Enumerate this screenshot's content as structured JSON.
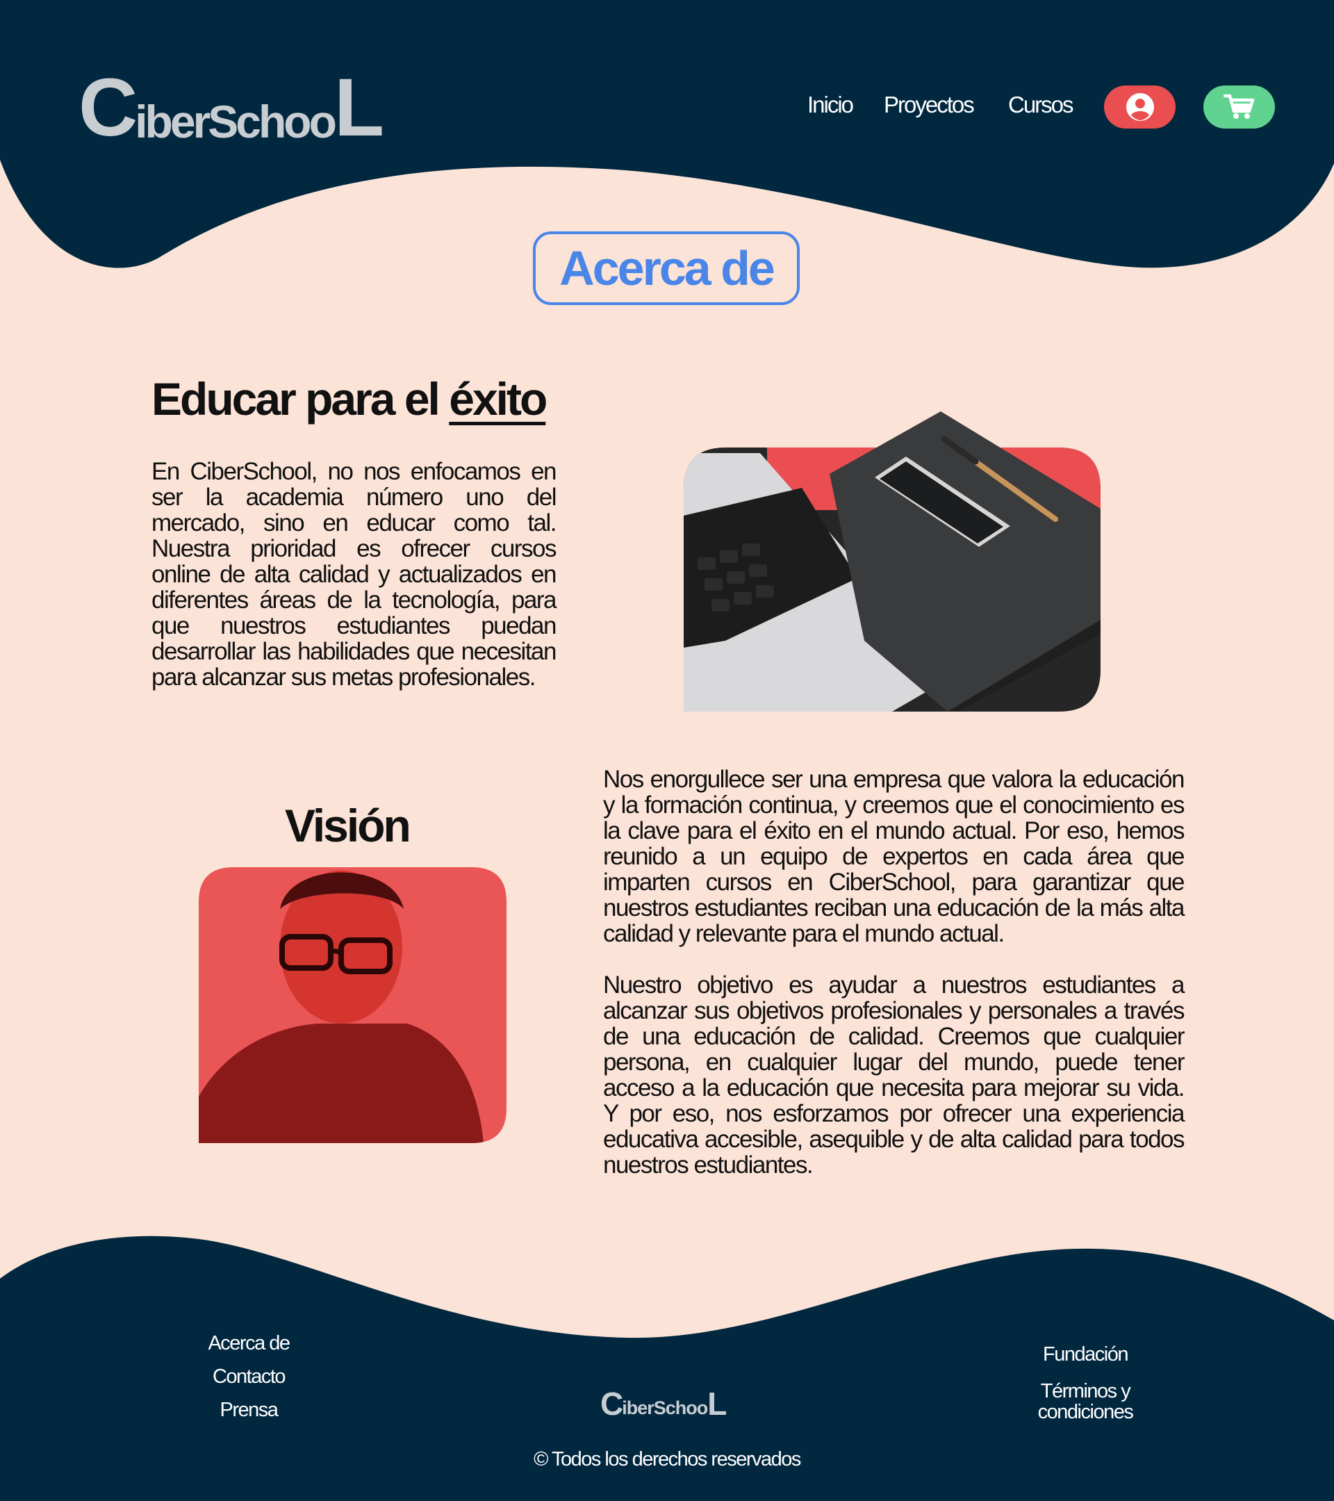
{
  "header": {
    "logo_big_c": "C",
    "logo_middle": "iberSchoo",
    "logo_big_l": "L",
    "nav": {
      "home": "Inicio",
      "projects": "Proyectos",
      "courses": "Cursos"
    }
  },
  "colors": {
    "navy": "#022840",
    "peach": "#fce3d7",
    "accent_blue": "#4a86e8",
    "user_button": "#ea4e50",
    "cart_button": "#5fd38f",
    "logo_grey": "#c8cdd2"
  },
  "icons": {
    "user": "user-circle-icon",
    "cart": "shopping-cart-icon"
  },
  "page": {
    "title": "Acerca de"
  },
  "about": {
    "heading_prefix": "Educar para el",
    "heading_underlined": "éxito",
    "body": "En CiberSchool, no nos enfocamos en ser la academia número uno del mercado, sino en educar como tal. Nuestra prioridad es ofrecer cursos online de alta calidad y actualizados en diferentes áreas de la tecnología, para que nuestros estudiantes puedan desarrollar las habilidades que necesitan para alcanzar sus metas profesionales."
  },
  "vision": {
    "heading": "Visión",
    "para1": "Nos enorgullece ser una empresa que valora la educación y la formación continua, y creemos que el conocimiento es la clave para el éxito en el mundo actual. Por eso, hemos reunido a un equipo de expertos en cada área que imparten cursos en CiberSchool, para garantizar que nuestros estudiantes reciban una educación de la más alta calidad y relevante para el mundo actual.",
    "para2": "Nuestro objetivo es ayudar a nuestros estudiantes a alcanzar sus objetivos profesionales y personales a través de una educación de calidad. Creemos que cualquier persona, en cualquier lugar del mundo, puede tener acceso a la educación que necesita para mejorar su vida. Y por eso, nos esforzamos por ofrecer una experiencia educativa accesible, asequible y de alta calidad para todos nuestros estudiantes."
  },
  "footer": {
    "left_links": [
      "Acerca de",
      "Contacto",
      "Prensa"
    ],
    "right_links": [
      "Fundación",
      "Términos y",
      "condiciones"
    ],
    "copyright": "© Todos los derechos reservados"
  }
}
